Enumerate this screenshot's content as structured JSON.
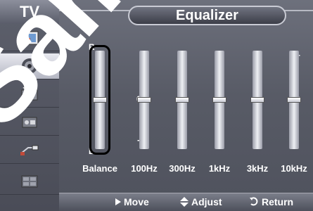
{
  "sidebar": {
    "title": "TV",
    "items": [
      {
        "icon": "picture-icon",
        "active": false
      },
      {
        "icon": "sound-icon",
        "active": true
      },
      {
        "icon": "channel-icon",
        "active": false
      },
      {
        "icon": "setup-icon",
        "active": false
      },
      {
        "icon": "input-icon",
        "active": false
      },
      {
        "icon": "application-icon",
        "active": false
      }
    ]
  },
  "header": {
    "title": "Equalizer"
  },
  "balance_scale": {
    "top": "R",
    "bottom": "L"
  },
  "band_scale": {
    "top": "+",
    "middle": "0",
    "bottom": "-"
  },
  "sliders": [
    {
      "label": "Balance",
      "value": 0
    },
    {
      "label": "100Hz",
      "value": 0
    },
    {
      "label": "300Hz",
      "value": 0
    },
    {
      "label": "1kHz",
      "value": 0
    },
    {
      "label": "3kHz",
      "value": 0
    },
    {
      "label": "10kHz",
      "value": 0
    }
  ],
  "footer": {
    "move": "Move",
    "adjust": "Adjust",
    "return": "Return"
  },
  "watermark": "Sample",
  "colors": {
    "panel": "#5a5c68",
    "active_item": "#d6d8e0",
    "text": "#ffffff"
  }
}
